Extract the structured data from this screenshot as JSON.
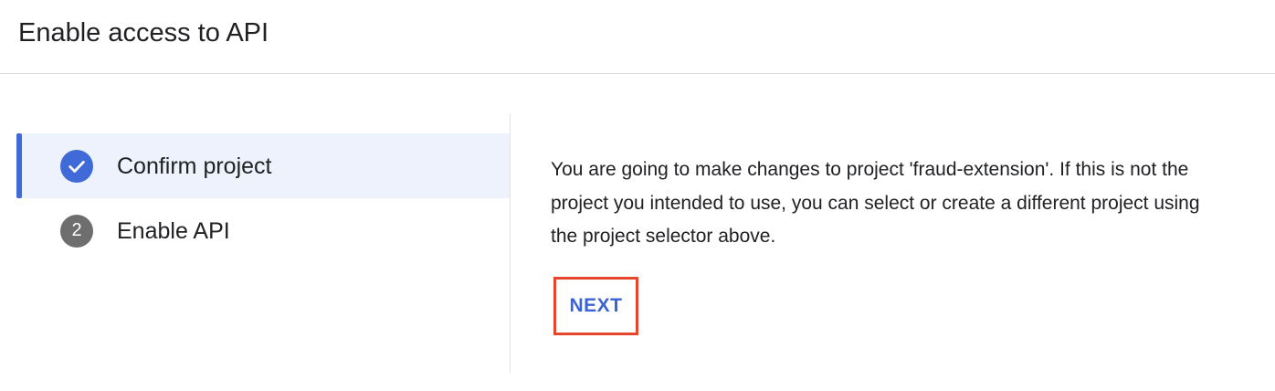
{
  "header": {
    "title": "Enable access to API"
  },
  "stepper": {
    "steps": [
      {
        "label": "Confirm project",
        "state": "completed",
        "icon": "check-icon"
      },
      {
        "label": "Enable API",
        "state": "pending",
        "number": "2"
      }
    ]
  },
  "content": {
    "message": "You are going to make changes to project 'fraud-extension'. If this is not the project you intended to use, you can select or create a different project using the project selector above.",
    "next_label": "NEXT"
  },
  "colors": {
    "accent": "#3f6ad8",
    "active_step_bg": "#eef2fc",
    "highlight_border": "#e5462c",
    "pending_icon": "#6e6e6e"
  }
}
